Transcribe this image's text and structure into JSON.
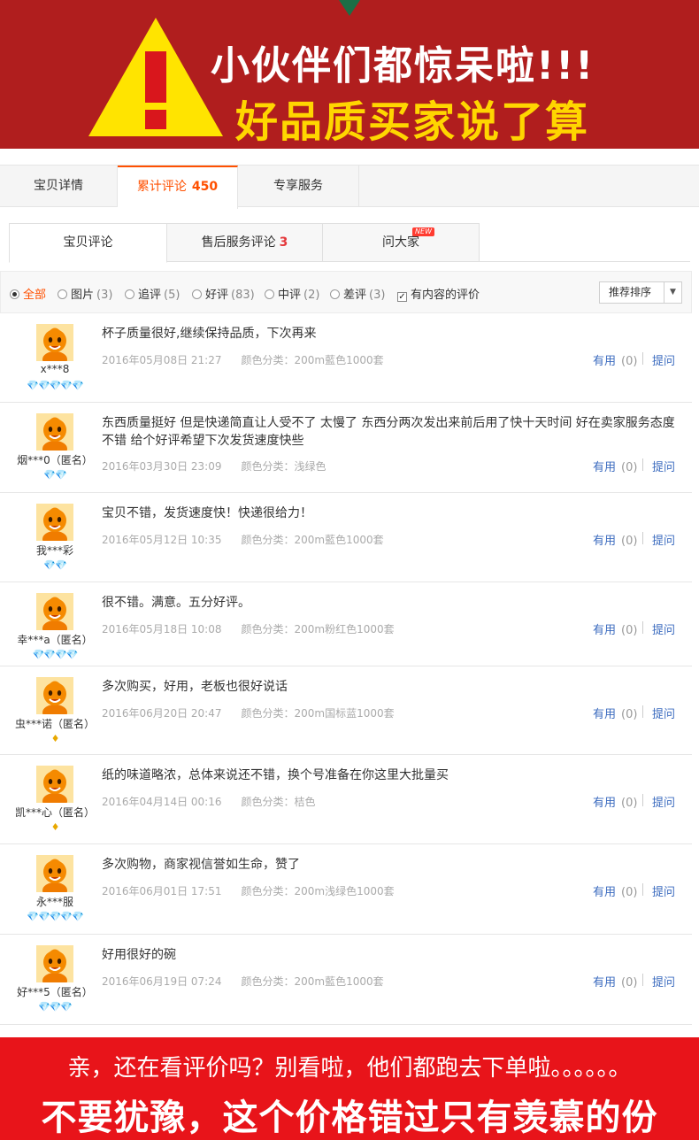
{
  "banner": {
    "headline": "小伙伴们都惊呆啦!!!",
    "subline": "好品质买家说了算",
    "warning_mark": "!",
    "colors": {
      "background": "#b01e1e",
      "triangle": "#ffe400",
      "mark": "#d9161c",
      "subline": "#ffd600"
    }
  },
  "main_tabs": [
    {
      "label": "宝贝详情",
      "count": ""
    },
    {
      "label": "累计评论",
      "count": "450"
    },
    {
      "label": "专享服务",
      "count": ""
    }
  ],
  "sub_tabs": [
    {
      "label": "宝贝评论",
      "count": ""
    },
    {
      "label": "售后服务评论",
      "count": "3"
    },
    {
      "label": "问大家",
      "count": "",
      "badge": "NEW"
    }
  ],
  "filters": {
    "options": [
      {
        "label": "全部",
        "count": ""
      },
      {
        "label": "图片",
        "count": "(3)"
      },
      {
        "label": "追评",
        "count": "(5)"
      },
      {
        "label": "好评",
        "count": "(83)"
      },
      {
        "label": "中评",
        "count": "(2)"
      },
      {
        "label": "差评",
        "count": "(3)"
      }
    ],
    "content_only": "有内容的评价",
    "sort_label": "推荐排序",
    "accent": "#ff5000"
  },
  "reviews": [
    {
      "user": "x***8",
      "rank": "💎💎💎💎💎",
      "text": "杯子质量很好,继续保持品质，下次再来",
      "date": "2016年05月08日 21:27",
      "sku": "颜色分类：200m藍色1000套",
      "useful_label": "有用",
      "useful_count": "(0)",
      "ask_label": "提问"
    },
    {
      "user": "烟***0（匿名）",
      "rank": "💎💎",
      "text": "东西质量挺好 但是快递简直让人受不了 太慢了 东西分两次发出来前后用了快十天时间 好在卖家服务态度不错 给个好评希望下次发货速度快些",
      "date": "2016年03月30日 23:09",
      "sku": "颜色分类：浅绿色",
      "useful_label": "有用",
      "useful_count": "(0)",
      "ask_label": "提问"
    },
    {
      "user": "我***彩",
      "rank": "💎💎",
      "text": "宝贝不错，发货速度快！快递很给力！",
      "date": "2016年05月12日 10:35",
      "sku": "颜色分类：200m藍色1000套",
      "useful_label": "有用",
      "useful_count": "(0)",
      "ask_label": "提问"
    },
    {
      "user": "幸***a（匿名）",
      "rank": "💎💎💎💎",
      "text": "很不错。满意。五分好评。",
      "date": "2016年05月18日 10:08",
      "sku": "颜色分类：200m粉红色1000套",
      "useful_label": "有用",
      "useful_count": "(0)",
      "ask_label": "提问"
    },
    {
      "user": "虫***诺（匿名）",
      "rank": "♦",
      "text": "多次购买，好用，老板也很好说话",
      "date": "2016年06月20日 20:47",
      "sku": "颜色分类：200m国标蓝1000套",
      "useful_label": "有用",
      "useful_count": "(0)",
      "ask_label": "提问"
    },
    {
      "user": "凯***心（匿名）",
      "rank": "♦",
      "text": "纸的味道略浓，总体来说还不错，换个号准备在你这里大批量买",
      "date": "2016年04月14日 00:16",
      "sku": "颜色分类：桔色",
      "useful_label": "有用",
      "useful_count": "(0)",
      "ask_label": "提问"
    },
    {
      "user": "永***服",
      "rank": "💎💎💎💎💎",
      "text": "多次购物，商家视信誉如生命，赞了",
      "date": "2016年06月01日 17:51",
      "sku": "颜色分类：200m浅绿色1000套",
      "useful_label": "有用",
      "useful_count": "(0)",
      "ask_label": "提问"
    },
    {
      "user": "好***5（匿名）",
      "rank": "💎💎💎",
      "text": "好用很好的碗",
      "date": "2016年06月19日 07:24",
      "sku": "颜色分类：200m藍色1000套",
      "useful_label": "有用",
      "useful_count": "(0)",
      "ask_label": "提问"
    }
  ],
  "footer_banner": {
    "line1": "亲，还在看评价吗？别看啦，他们都跑去下单啦。。。。。。",
    "line2": "不要犹豫，这个价格错过只有羡慕的份",
    "background": "#e8141a"
  }
}
